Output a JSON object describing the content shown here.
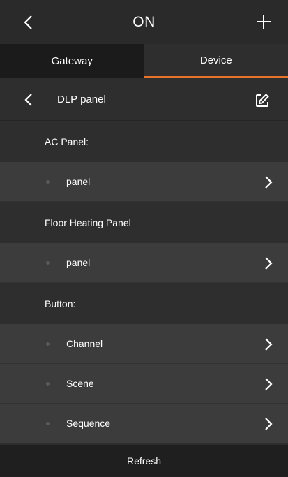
{
  "header": {
    "title": "ON",
    "back_icon": "chevron-left-icon",
    "add_icon": "plus-icon"
  },
  "tabs": [
    {
      "label": "Gateway",
      "active": false
    },
    {
      "label": "Device",
      "active": true
    }
  ],
  "subheader": {
    "label": "DLP panel",
    "back_icon": "chevron-left-icon",
    "edit_icon": "edit-icon"
  },
  "sections": [
    {
      "title": "AC Panel:",
      "items": [
        {
          "label": "panel"
        }
      ]
    },
    {
      "title": "Floor Heating Panel",
      "items": [
        {
          "label": "panel"
        }
      ]
    },
    {
      "title": "Button:",
      "items": [
        {
          "label": "Channel"
        },
        {
          "label": "Scene"
        },
        {
          "label": "Sequence"
        }
      ]
    }
  ],
  "refresh_label": "Refresh",
  "colors": {
    "accent": "#e8742c",
    "background": "#2e2e2e",
    "row": "#3c3c3c"
  }
}
